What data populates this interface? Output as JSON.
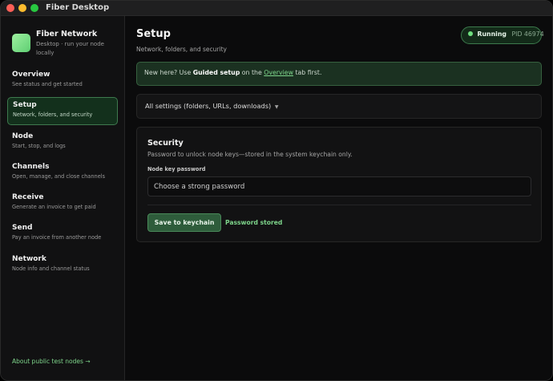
{
  "window": {
    "title": "Fiber Desktop"
  },
  "brand": {
    "name": "Fiber Network",
    "subtitle": "Desktop · run your node locally"
  },
  "sidebar": {
    "items": [
      {
        "title": "Overview",
        "desc": "See status and get started"
      },
      {
        "title": "Setup",
        "desc": "Network, folders, and security"
      },
      {
        "title": "Node",
        "desc": "Start, stop, and logs"
      },
      {
        "title": "Channels",
        "desc": "Open, manage, and close channels"
      },
      {
        "title": "Receive",
        "desc": "Generate an invoice to get paid"
      },
      {
        "title": "Send",
        "desc": "Pay an invoice from another node"
      },
      {
        "title": "Network",
        "desc": "Node info and channel status"
      }
    ],
    "active_index": 1,
    "footer_link": "About public test nodes →"
  },
  "main": {
    "title": "Setup",
    "subtitle": "Network, folders, and security",
    "status": {
      "label": "Running",
      "pid": "PID 46974",
      "color": "#6fe07f"
    },
    "banner": {
      "prefix": "New here? Use ",
      "bold": "Guided setup",
      "middle": " on the ",
      "link": "Overview",
      "suffix": " tab first."
    },
    "disclosure": {
      "label": "All settings (folders, URLs, downloads)",
      "caret": "▼"
    },
    "security": {
      "title": "Security",
      "description": "Password to unlock node keys—stored in the system keychain only.",
      "field_label": "Node key password",
      "placeholder": "Choose a strong password",
      "value": "",
      "button": "Save to keychain",
      "status": "Password stored"
    }
  },
  "colors": {
    "accent": "#7ed58b",
    "active_bg": "#13301c",
    "banner_bg": "#1b3121",
    "button_bg": "#2e5c3b"
  }
}
